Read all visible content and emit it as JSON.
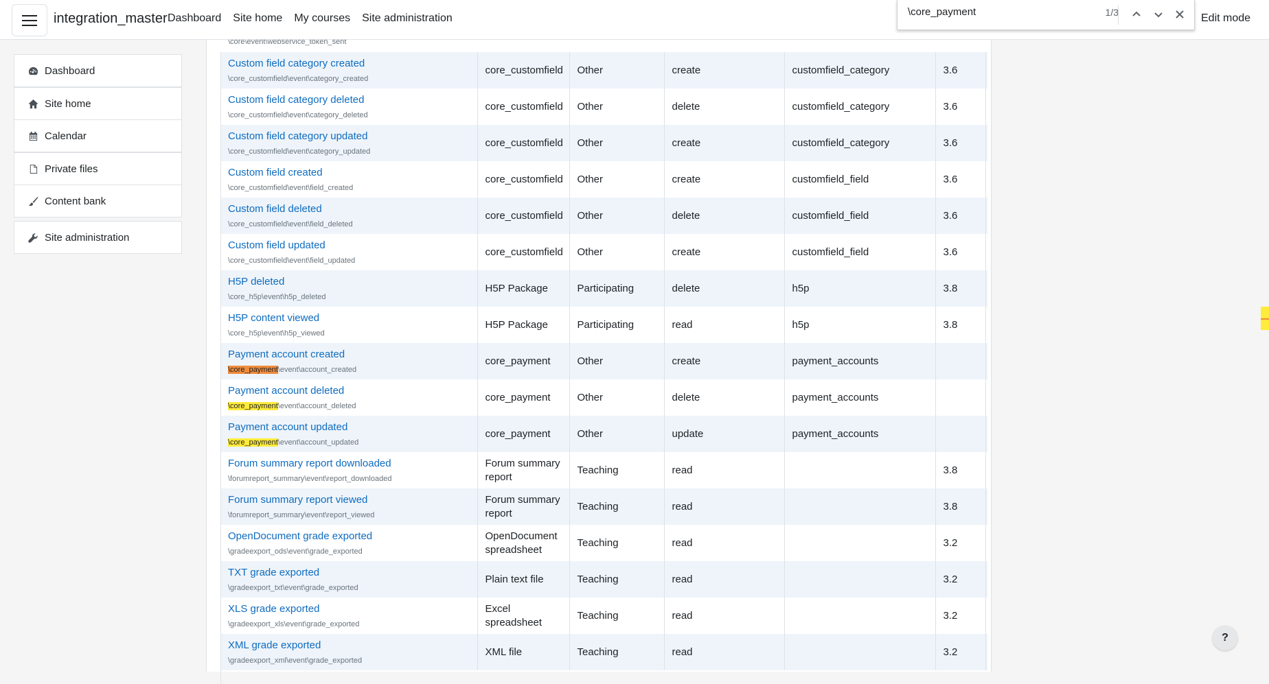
{
  "navbar": {
    "brand": "integration_master",
    "links": [
      "Dashboard",
      "Site home",
      "My courses",
      "Site administration"
    ],
    "edit_mode": "Edit mode"
  },
  "find": {
    "query": "\\core_payment",
    "count": "1/3"
  },
  "sidebar": {
    "items": [
      {
        "label": "Dashboard",
        "icon": "dashboard-icon"
      },
      {
        "label": "Site home",
        "icon": "home-icon"
      },
      {
        "label": "Calendar",
        "icon": "calendar-icon"
      },
      {
        "label": "Private files",
        "icon": "file-icon"
      },
      {
        "label": "Content bank",
        "icon": "paintbrush-icon"
      },
      {
        "label": "Site administration",
        "icon": "wrench-icon"
      }
    ]
  },
  "table": {
    "top_fragment": "\\core\\event\\webservice_token_sent",
    "rows": [
      {
        "name": "Custom field category created",
        "path": "\\core_customfield\\event\\category_created",
        "component": "core_customfield",
        "edulevel": "Other",
        "crud": "create",
        "table": "customfield_category",
        "since": "3.6"
      },
      {
        "name": "Custom field category deleted",
        "path": "\\core_customfield\\event\\category_deleted",
        "component": "core_customfield",
        "edulevel": "Other",
        "crud": "delete",
        "table": "customfield_category",
        "since": "3.6"
      },
      {
        "name": "Custom field category updated",
        "path": "\\core_customfield\\event\\category_updated",
        "component": "core_customfield",
        "edulevel": "Other",
        "crud": "create",
        "table": "customfield_category",
        "since": "3.6"
      },
      {
        "name": "Custom field created",
        "path": "\\core_customfield\\event\\field_created",
        "component": "core_customfield",
        "edulevel": "Other",
        "crud": "create",
        "table": "customfield_field",
        "since": "3.6"
      },
      {
        "name": "Custom field deleted",
        "path": "\\core_customfield\\event\\field_deleted",
        "component": "core_customfield",
        "edulevel": "Other",
        "crud": "delete",
        "table": "customfield_field",
        "since": "3.6"
      },
      {
        "name": "Custom field updated",
        "path": "\\core_customfield\\event\\field_updated",
        "component": "core_customfield",
        "edulevel": "Other",
        "crud": "create",
        "table": "customfield_field",
        "since": "3.6"
      },
      {
        "name": "H5P deleted",
        "path": "\\core_h5p\\event\\h5p_deleted",
        "component": "H5P Package",
        "edulevel": "Participating",
        "crud": "delete",
        "table": "h5p",
        "since": "3.8"
      },
      {
        "name": "H5P content viewed",
        "path": "\\core_h5p\\event\\h5p_viewed",
        "component": "H5P Package",
        "edulevel": "Participating",
        "crud": "read",
        "table": "h5p",
        "since": "3.8"
      },
      {
        "name": "Payment account created",
        "path_hl": "\\core_payment",
        "path_rest": "\\event\\account_created",
        "hl_current": true,
        "component": "core_payment",
        "edulevel": "Other",
        "crud": "create",
        "table": "payment_accounts",
        "since": ""
      },
      {
        "name": "Payment account deleted",
        "path_hl": "\\core_payment",
        "path_rest": "\\event\\account_deleted",
        "hl_current": false,
        "component": "core_payment",
        "edulevel": "Other",
        "crud": "delete",
        "table": "payment_accounts",
        "since": ""
      },
      {
        "name": "Payment account updated",
        "path_hl": "\\core_payment",
        "path_rest": "\\event\\account_updated",
        "hl_current": false,
        "component": "core_payment",
        "edulevel": "Other",
        "crud": "update",
        "table": "payment_accounts",
        "since": ""
      },
      {
        "name": "Forum summary report downloaded",
        "path": "\\forumreport_summary\\event\\report_downloaded",
        "component": "Forum summary report",
        "edulevel": "Teaching",
        "crud": "read",
        "table": "",
        "since": "3.8"
      },
      {
        "name": "Forum summary report viewed",
        "path": "\\forumreport_summary\\event\\report_viewed",
        "component": "Forum summary report",
        "edulevel": "Teaching",
        "crud": "read",
        "table": "",
        "since": "3.8"
      },
      {
        "name": "OpenDocument grade exported",
        "path": "\\gradeexport_ods\\event\\grade_exported",
        "component": "OpenDocument spreadsheet",
        "edulevel": "Teaching",
        "crud": "read",
        "table": "",
        "since": "3.2"
      },
      {
        "name": "TXT grade exported",
        "path": "\\gradeexport_txt\\event\\grade_exported",
        "component": "Plain text file",
        "edulevel": "Teaching",
        "crud": "read",
        "table": "",
        "since": "3.2"
      },
      {
        "name": "XLS grade exported",
        "path": "\\gradeexport_xls\\event\\grade_exported",
        "component": "Excel spreadsheet",
        "edulevel": "Teaching",
        "crud": "read",
        "table": "",
        "since": "3.2"
      },
      {
        "name": "XML grade exported",
        "path": "\\gradeexport_xml\\event\\grade_exported",
        "component": "XML file",
        "edulevel": "Teaching",
        "crud": "read",
        "table": "",
        "since": "3.2"
      }
    ]
  },
  "help": "?"
}
